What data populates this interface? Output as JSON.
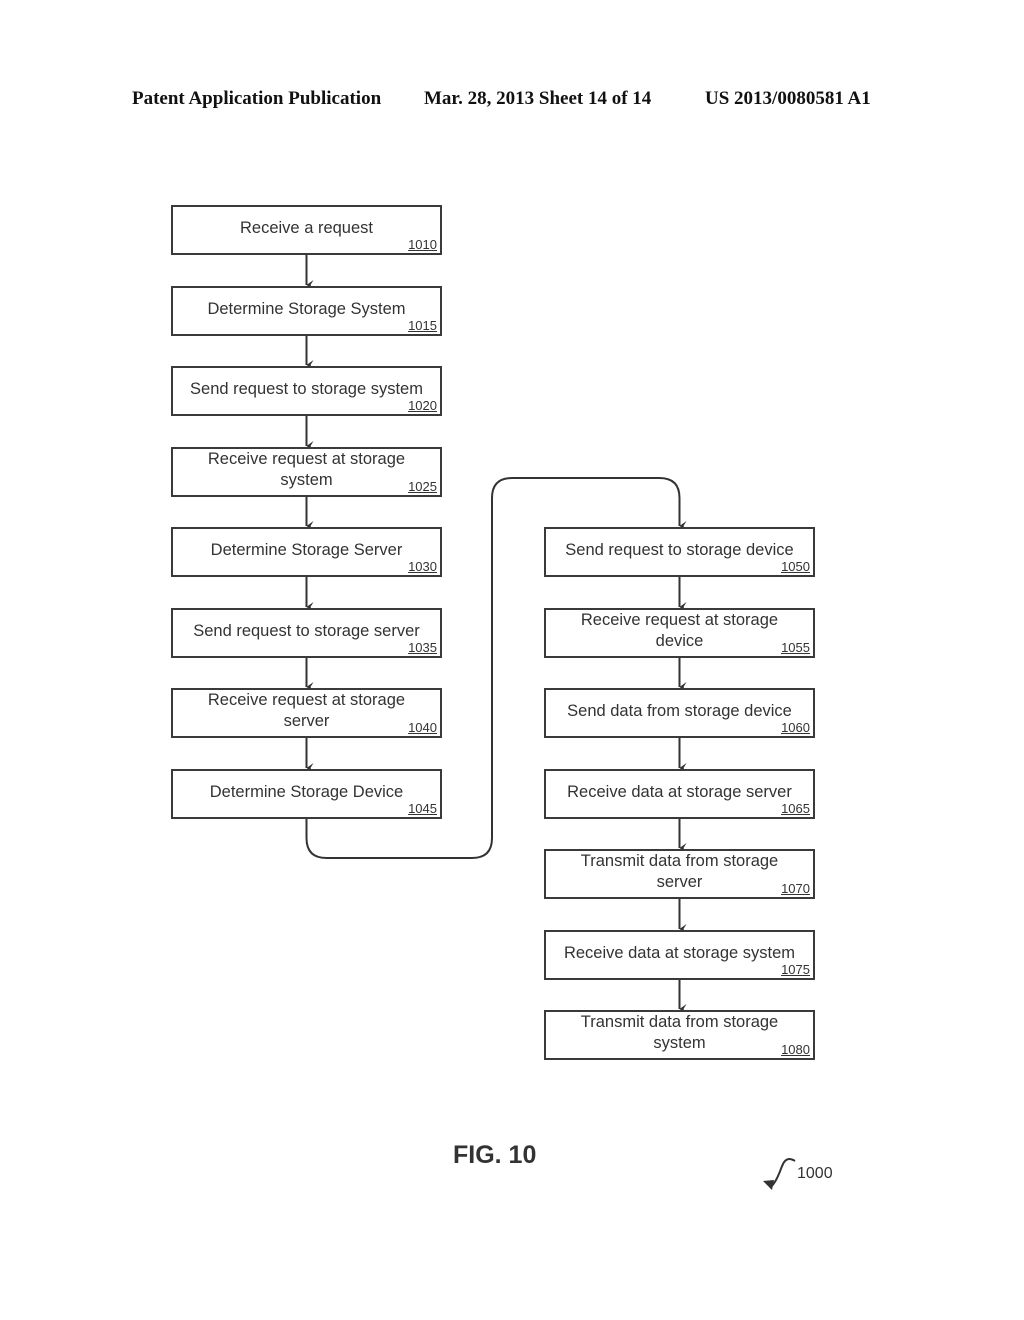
{
  "header": {
    "publication": "Patent Application Publication",
    "date_sheet": "Mar. 28, 2013  Sheet 14 of 14",
    "patent_number": "US 2013/0080581 A1"
  },
  "flowchart": {
    "left_column": [
      {
        "label": "Receive a request",
        "ref": "1010"
      },
      {
        "label": "Determine Storage System",
        "ref": "1015"
      },
      {
        "label": "Send request to storage system",
        "ref": "1020"
      },
      {
        "label": "Receive request at storage system",
        "ref": "1025"
      },
      {
        "label": "Determine Storage Server",
        "ref": "1030"
      },
      {
        "label": "Send request to storage server",
        "ref": "1035"
      },
      {
        "label": "Receive request at storage server",
        "ref": "1040"
      },
      {
        "label": "Determine Storage Device",
        "ref": "1045"
      }
    ],
    "right_column": [
      {
        "label": "Send request to storage device",
        "ref": "1050"
      },
      {
        "label": "Receive request at storage device",
        "ref": "1055"
      },
      {
        "label": "Send data from storage device",
        "ref": "1060"
      },
      {
        "label": "Receive data at storage server",
        "ref": "1065"
      },
      {
        "label": "Transmit data from storage server",
        "ref": "1070"
      },
      {
        "label": "Receive data at storage system",
        "ref": "1075"
      },
      {
        "label": "Transmit data from storage system",
        "ref": "1080"
      }
    ]
  },
  "figure": {
    "title": "FIG. 10",
    "ref": "1000"
  }
}
